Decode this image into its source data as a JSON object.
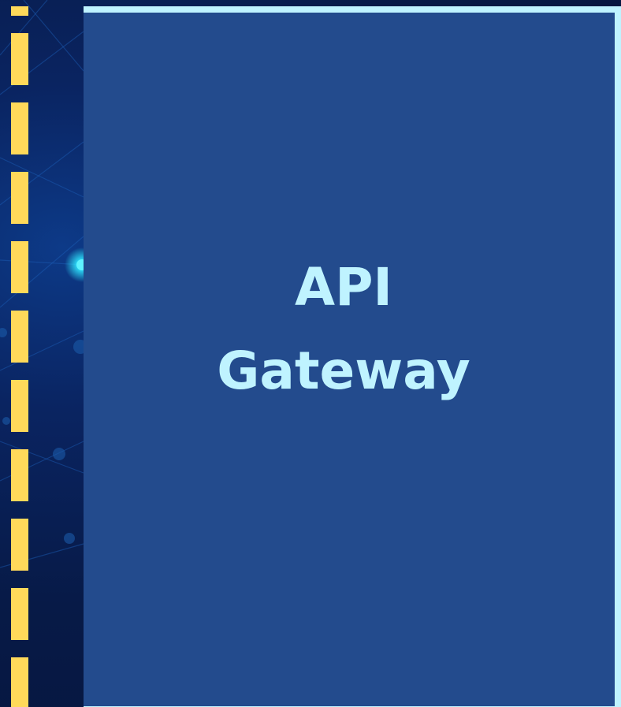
{
  "diagram": {
    "node": {
      "label_line1": "API",
      "label_line2": "Gateway"
    },
    "colors": {
      "background": "#07163d",
      "node_fill": "#234b8d",
      "node_border": "#bff3ff",
      "label": "#bff3ff",
      "connector_dash": "#ffd95a",
      "glow": "#2ee6ff"
    },
    "connector": {
      "style": "dashed",
      "orientation": "vertical"
    }
  }
}
